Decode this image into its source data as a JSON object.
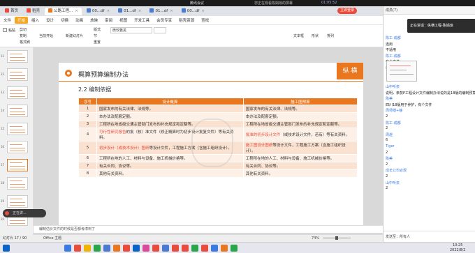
{
  "meeting": {
    "title": "腾讯会议",
    "center": "您正在观看陈娟琼的屏幕",
    "speaker": "陈娟琼",
    "timer": "01:05:52"
  },
  "tabs": [
    {
      "label": "首页",
      "color": "#e84c3d"
    },
    {
      "label": "稻壳",
      "color": "#e84c3d"
    },
    {
      "label": "公路工程...",
      "color": "#e8771f",
      "active": true
    },
    {
      "label": "00...df",
      "color": "#4a7bd0"
    },
    {
      "label": "01...df",
      "color": "#4a7bd0"
    },
    {
      "label": "01...df",
      "color": "#4a7bd0"
    },
    {
      "label": "00...df",
      "color": "#4a7bd0"
    }
  ],
  "login_label": "立即登录",
  "menu": [
    "文件",
    "开始",
    "插入",
    "设计",
    "切换",
    "动画",
    "放映",
    "审阅",
    "视图",
    "开发工具",
    "会员专享",
    "稻壳资源",
    "查找"
  ],
  "menu_active": "开始",
  "ribbon": {
    "paste": "粘贴",
    "cut": "剪切",
    "copy": "复制",
    "format": "格式刷",
    "current_start": "当前开始",
    "new_slide": "新建幻灯片",
    "layout": "版式",
    "section": "节",
    "redo": "重置",
    "font_name": "微软雅黑",
    "textbox": "文本框",
    "shape": "形状",
    "arrange": "排列"
  },
  "slide": {
    "title": "概算预算编制办法",
    "brand": "纵 横",
    "section": "2.2  编制依据",
    "headers": [
      "序号",
      "设计概算",
      "施工图预算"
    ],
    "rows": [
      [
        "1",
        "国家发布的有关法律、法规等。",
        "国家发布的有关法律、法规等。"
      ],
      [
        "2",
        "本办法及配套定额。",
        "本办法及配套定额。"
      ],
      [
        "3",
        "工程所在地省级交通主管部门发布的补充规定和定额等。",
        "工程所在地省级交通主管部门发布的补充规定和定额等。"
      ],
      [
        "4",
        "可行性研究报告的批（核）准文件（修正概算时为初步设计批复文件）等有关资料。",
        "批准的初步设计文件（或技术设计文件，若有）等有关资料。"
      ],
      [
        "5",
        "初步设计（或技术设计）图纸等设计文件，工程施工方案（含施工组织设计）。",
        "施工图设计图纸等设计文件，工程施工方案（含施工组织设计）。"
      ],
      [
        "6",
        "工程所在地的人工、材料与设备、施工机械价格等。",
        "工程所在地的人工、材料与设备、施工机械价格等。"
      ],
      [
        "7",
        "有关合同、协议等。",
        "有关合同、协议等。"
      ],
      [
        "8",
        "其他有关资料。",
        "其他有关资料。"
      ]
    ],
    "highlights": {
      "r4a": "可行性研究报告",
      "r4b": "批准的初步设计文件",
      "r5a": "初步设计（或技术设计）图纸",
      "r5b": "施工图设计图纸"
    }
  },
  "notes": "编制估价文件的时候是否都考虑到了",
  "status": {
    "slide_count": "幻灯片 17 / 90",
    "theme": "Office 主题",
    "zoom": "74%"
  },
  "floating": "正在讲...",
  "thumbs": [
    "11",
    "12",
    "13",
    "14",
    "15",
    "16",
    "17",
    "18",
    "19",
    "20"
  ],
  "chat": {
    "header": "成员(7)",
    "popup": "正在讲话：纵横工程-陈娟琼",
    "messages": [
      {
        "type": "name",
        "text": "陈工-成都"
      },
      {
        "type": "txt",
        "text": "连用"
      },
      {
        "type": "txt",
        "text": "不适用"
      },
      {
        "type": "name",
        "text": "陈工-成都"
      },
      {
        "type": "txt",
        "text": "有个文件"
      },
      {
        "type": "name",
        "text": "纵横造价-王蕾"
      },
      {
        "type": "name",
        "text": "山中听泉"
      },
      {
        "type": "txt",
        "text": "说明，条款P工程设计文件编制办法说的是18版的编制预算"
      },
      {
        "type": "name",
        "text": "陈美"
      },
      {
        "type": "txt",
        "text": "四川18版用于养护，有个文件"
      },
      {
        "type": "name",
        "text": "周师傅+静"
      },
      {
        "type": "txt",
        "text": "2"
      },
      {
        "type": "name",
        "text": "陈工-成都"
      },
      {
        "type": "txt",
        "text": "2"
      },
      {
        "type": "name",
        "text": "周煜"
      },
      {
        "type": "txt",
        "text": "6"
      },
      {
        "type": "name",
        "text": "Tiger"
      },
      {
        "type": "txt",
        "text": "2"
      },
      {
        "type": "name",
        "text": "陈美"
      },
      {
        "type": "txt",
        "text": "2"
      },
      {
        "type": "name",
        "text": "成长公司合规"
      },
      {
        "type": "txt",
        "text": "2"
      },
      {
        "type": "name",
        "text": "山中听泉"
      },
      {
        "type": "txt",
        "text": "2"
      }
    ],
    "input_label": "发送至：所有人"
  },
  "clock": {
    "time": "10:25",
    "date": "2022/8/2"
  },
  "colors": {
    "accent": "#e8771f",
    "red": "#e84c3d"
  }
}
